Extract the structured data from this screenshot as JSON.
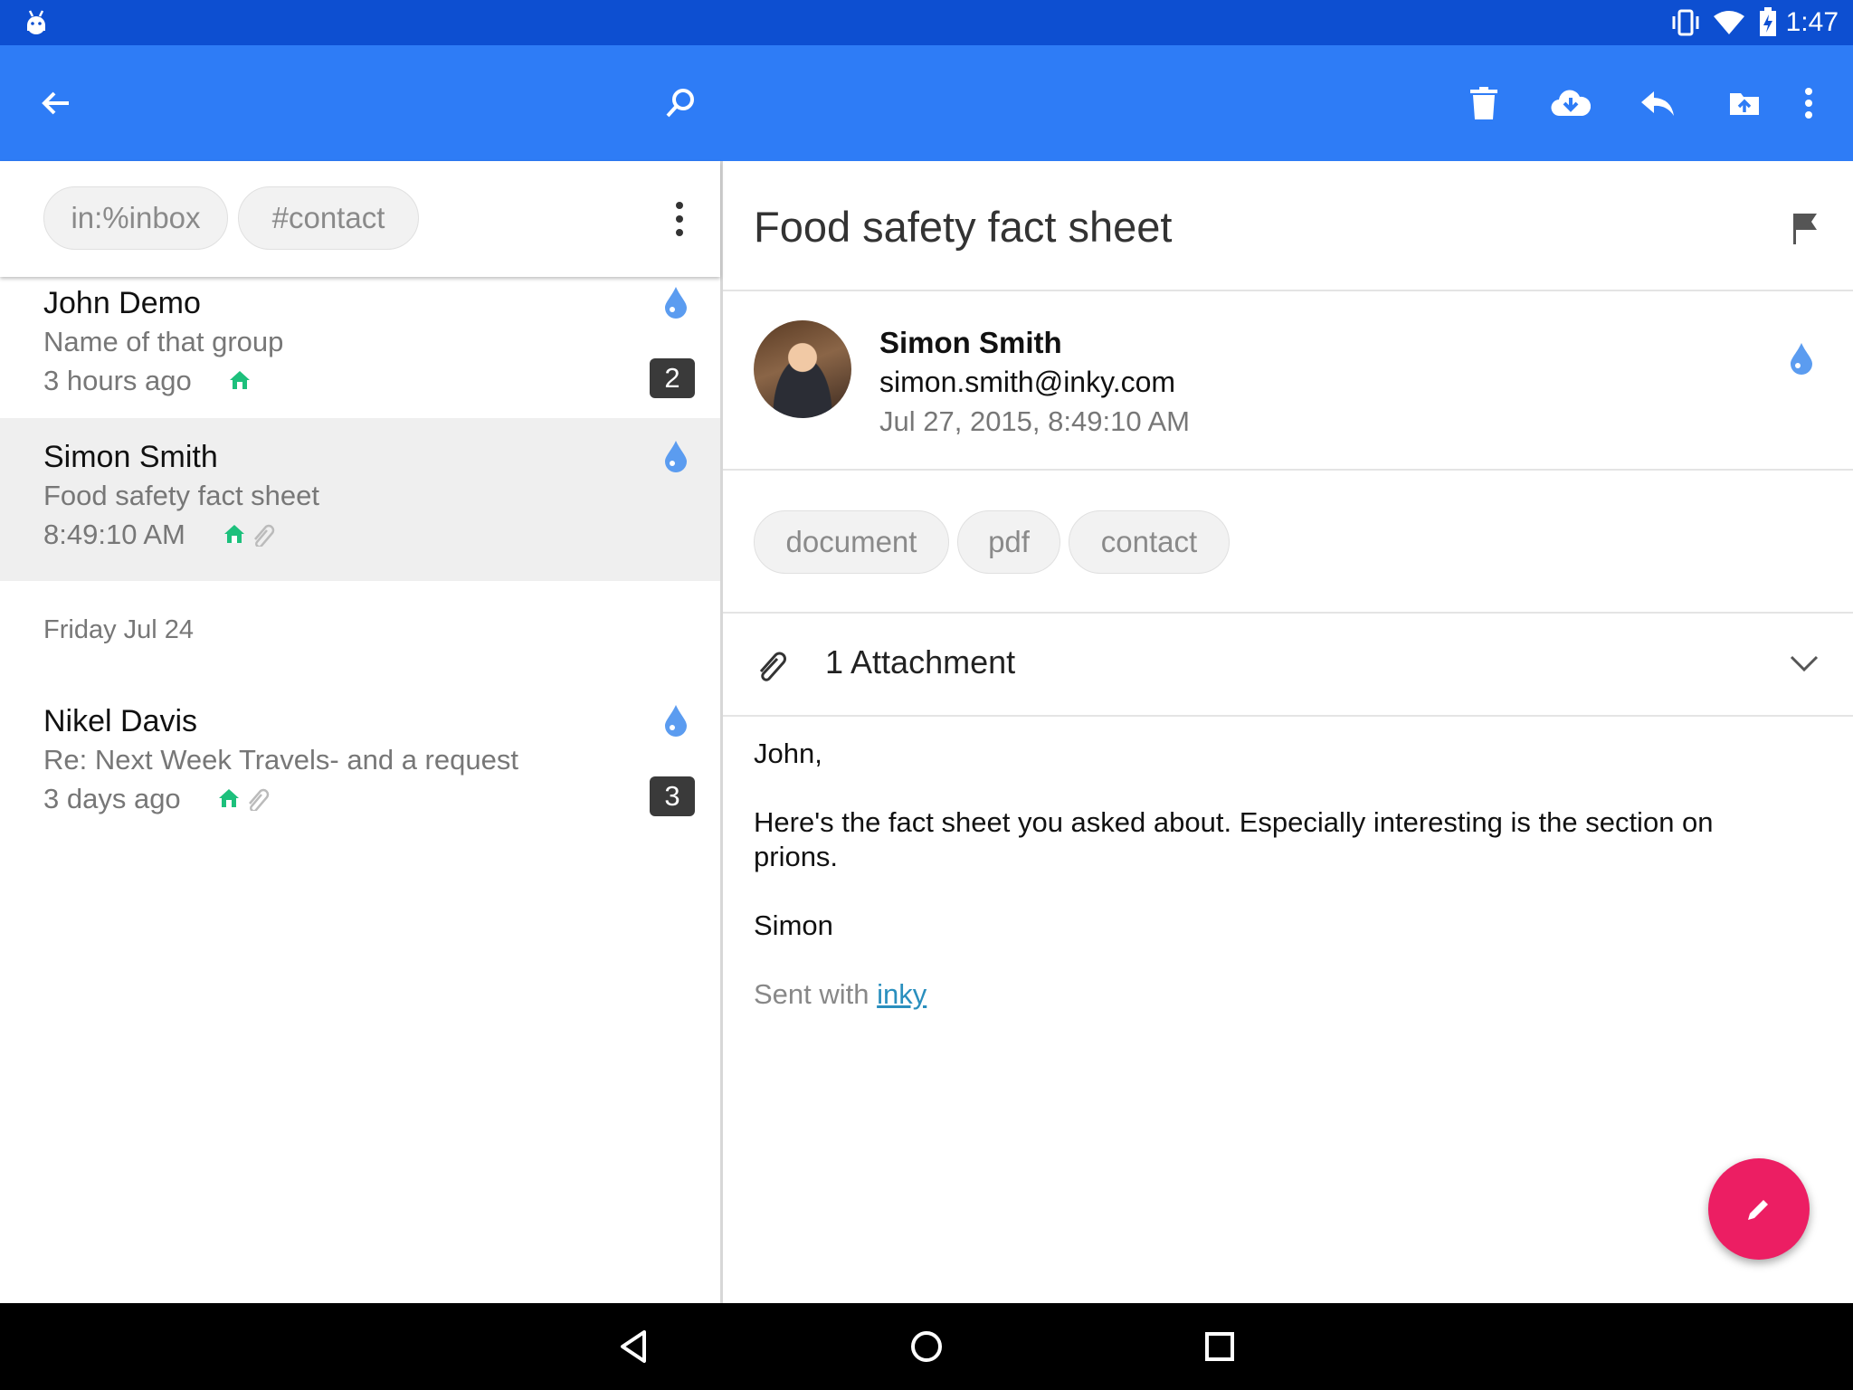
{
  "status_bar": {
    "time": "1:47"
  },
  "colors": {
    "primary": "#2e7cf6",
    "status_bar": "#0d4fd1",
    "fab": "#ec1e63",
    "accent_green": "#1dc07c",
    "drop_blue": "#5b9cf0",
    "count_badge": "#3a3a3a",
    "link": "#2a8fbe"
  },
  "toolbar": {
    "icons": [
      "back-arrow-icon",
      "search-icon",
      "trash-icon",
      "download-icon",
      "reply-icon",
      "move-folder-icon",
      "more-vert-icon"
    ]
  },
  "filters": [
    "in:%inbox",
    "#contact"
  ],
  "messages": [
    {
      "sender": "John Demo",
      "subject": "Name of that group",
      "time": "3 hours ago",
      "count": "2",
      "attachment": false
    },
    {
      "sender": "Simon Smith",
      "subject": "Food safety fact sheet",
      "time": "8:49:10 AM",
      "count": "",
      "attachment": true,
      "selected": true
    },
    {
      "sender": "Nikel Davis",
      "subject": "Re: Next Week Travels- and a request",
      "time": "3 days ago",
      "count": "3",
      "attachment": true
    }
  ],
  "date_headers": [
    "Friday Jul 24"
  ],
  "detail": {
    "subject": "Food safety fact sheet",
    "sender_name": "Simon Smith",
    "sender_email": "simon.smith@inky.com",
    "date": "Jul 27, 2015, 8:49:10 AM",
    "tags": [
      "document",
      "pdf",
      "contact"
    ],
    "attachment_label": "1 Attachment",
    "body": {
      "greeting": "John,",
      "paragraph": "Here's the fact sheet you asked about.  Especially interesting is the section on prions.",
      "signoff": "Simon",
      "sent_with_prefix": "Sent with ",
      "sent_with_link": "inky"
    }
  }
}
